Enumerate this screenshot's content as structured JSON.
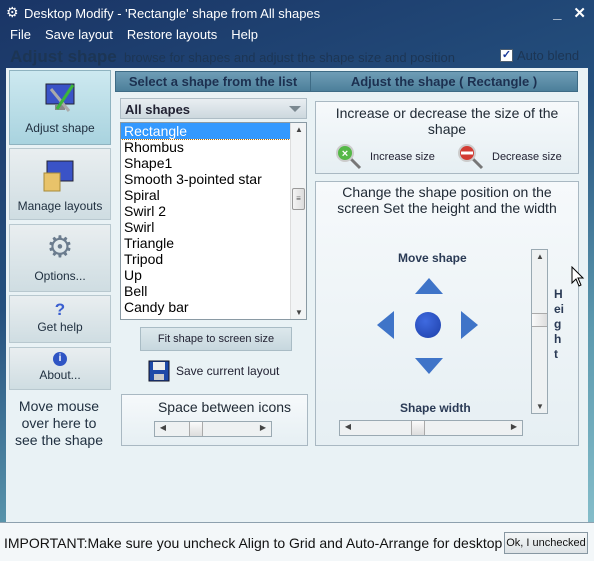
{
  "window": {
    "title": "Desktop Modify - 'Rectangle' shape from All shapes",
    "minimize": "_",
    "close": "✕"
  },
  "menu": [
    "File",
    "Save layout",
    "Restore layouts",
    "Help"
  ],
  "header": {
    "title": "Adjust shape",
    "subtitle": "browse for shapes and adjust the shape size and position",
    "auto_blend_label": "Auto blend",
    "auto_blend_checked": true
  },
  "nav": [
    {
      "label": "Adjust shape",
      "icon": "adjust-shape-icon",
      "active": true
    },
    {
      "label": "Manage layouts",
      "icon": "manage-layouts-icon"
    },
    {
      "label": "Options...",
      "icon": "gear-icon"
    },
    {
      "label": "Get help",
      "icon": "help-icon"
    },
    {
      "label": "About...",
      "icon": "info-icon"
    }
  ],
  "mouse_hint": "Move mouse over here to see the shape",
  "left_panel": {
    "header": "Select a shape from the list",
    "dropdown_value": "All shapes",
    "shapes": [
      "Rectangle",
      "Rhombus",
      "Shape1",
      "Smooth 3-pointed star",
      "Spiral",
      "Swirl 2",
      "Swirl",
      "Triangle",
      "Tripod",
      "Up",
      "Bell",
      "Candy bar"
    ],
    "selected": "Rectangle",
    "fit_button": "Fit shape to screen size",
    "save_button": "Save current layout",
    "space_label": "Space between icons"
  },
  "right_panel": {
    "header": "Adjust the shape ( Rectangle )",
    "size_title": "Increase or decrease the size of the shape",
    "increase": "Increase size",
    "decrease": "Decrease size",
    "position_title": "Change the shape position on the screen  Set the height and the width",
    "move_label": "Move shape",
    "width_label": "Shape width",
    "height_label": "Height"
  },
  "status": {
    "text": "IMPORTANT:Make sure you uncheck Align to Grid and Auto-Arrange for desktop icons",
    "ok_button": "Ok, I unchecked"
  },
  "colors": {
    "selection": "#3399ff",
    "arrow": "#3f74c8",
    "header_bar": "#5a8ba6"
  }
}
